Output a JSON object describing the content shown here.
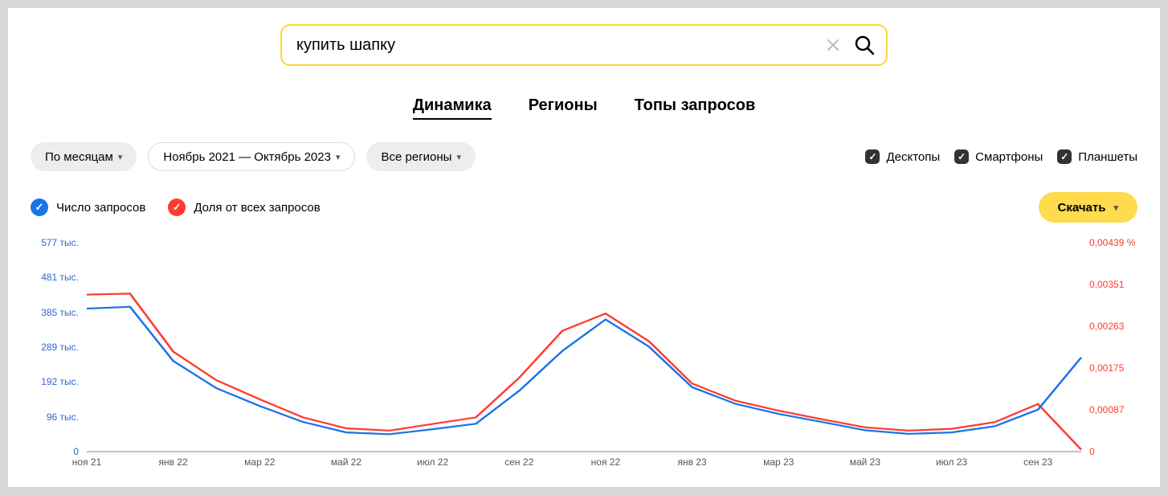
{
  "search": {
    "value": "купить шапку"
  },
  "tabs": {
    "dynamics": "Динамика",
    "regions": "Регионы",
    "tops": "Топы запросов",
    "active": "dynamics"
  },
  "filters": {
    "period_mode": "По месяцам",
    "date_range": "Ноябрь 2021 — Октябрь 2023",
    "region": "Все регионы"
  },
  "devices": {
    "desktop_label": "Десктопы",
    "smartphone_label": "Смартфоны",
    "tablet_label": "Планшеты"
  },
  "legend": {
    "series1": "Число запросов",
    "series2": "Доля от всех запросов"
  },
  "download_label": "Скачать",
  "y_left_ticks": [
    "577 тыс.",
    "481 тыс.",
    "385 тыс.",
    "289 тыс.",
    "192 тыс.",
    "96 тыс.",
    "0"
  ],
  "y_right_ticks": [
    "0,00439 %",
    "0,00351",
    "0,00263",
    "0,00175",
    "0,00087",
    "0"
  ],
  "x_ticks": [
    "ноя 21",
    "янв 22",
    "мар 22",
    "май 22",
    "июл 22",
    "сен 22",
    "ноя 22",
    "янв 23",
    "мар 23",
    "май 23",
    "июл 23",
    "сен 23"
  ],
  "chart_data": {
    "type": "line",
    "x_months": [
      "ноя 21",
      "дек 21",
      "янв 22",
      "фев 22",
      "мар 22",
      "апр 22",
      "май 22",
      "июн 22",
      "июл 22",
      "авг 22",
      "сен 22",
      "окт 22",
      "ноя 22",
      "дек 22",
      "янв 23",
      "фев 23",
      "мар 23",
      "апр 23",
      "май 23",
      "июн 23",
      "июл 23",
      "авг 23",
      "сен 23",
      "окт 23"
    ],
    "series": [
      {
        "name": "Число запросов",
        "color": "#1a73e8",
        "axis": "left",
        "unit": "тыс.",
        "values": [
          395,
          400,
          250,
          175,
          126,
          82,
          53,
          48,
          62,
          77,
          168,
          278,
          365,
          290,
          178,
          132,
          104,
          82,
          59,
          49,
          53,
          70,
          116,
          260
        ]
      },
      {
        "name": "Доля от всех запросов",
        "color": "#ff3b30",
        "axis": "right",
        "unit": "%",
        "values": [
          0.0033,
          0.00332,
          0.0021,
          0.0015,
          0.0011,
          0.00072,
          0.00049,
          0.00044,
          0.00058,
          0.00072,
          0.00155,
          0.00254,
          0.0029,
          0.00232,
          0.00143,
          0.00107,
          0.00086,
          0.00068,
          0.00051,
          0.00044,
          0.00048,
          0.00062,
          0.001,
          4e-05
        ]
      }
    ],
    "y_left_range": [
      0,
      577
    ],
    "y_right_range": [
      0,
      0.00439
    ],
    "xlabel": "",
    "y_left_label": "Число запросов (тыс.)",
    "y_right_label": "Доля от всех запросов (%)"
  }
}
